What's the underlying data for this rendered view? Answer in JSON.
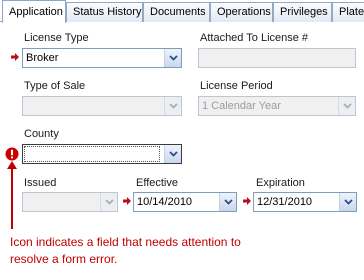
{
  "tabs": [
    "Application",
    "Status History",
    "Documents",
    "Operations",
    "Privileges",
    "Plates"
  ],
  "form": {
    "license_type": {
      "label": "License Type",
      "value": "Broker"
    },
    "attached_to_license": {
      "label": "Attached To License #",
      "value": ""
    },
    "type_of_sale": {
      "label": "Type of Sale",
      "value": ""
    },
    "license_period": {
      "label": "License Period",
      "value": "1 Calendar Year"
    },
    "county": {
      "label": "County",
      "value": ""
    },
    "issued": {
      "label": "Issued",
      "value": ""
    },
    "effective": {
      "label": "Effective",
      "value": "10/14/2010"
    },
    "expiration": {
      "label": "Expiration",
      "value": "12/31/2010"
    }
  },
  "callout": {
    "text": "Icon indicates a field that needs attention to resolve a form error."
  },
  "colors": {
    "required_marker": "#b3101b",
    "error_icon": "#cc0000",
    "callout": "#c00000"
  },
  "icons": {
    "required": "red-arrow-icon",
    "error": "exclamation-circle-icon",
    "dropdown": "chevron-down-icon"
  }
}
